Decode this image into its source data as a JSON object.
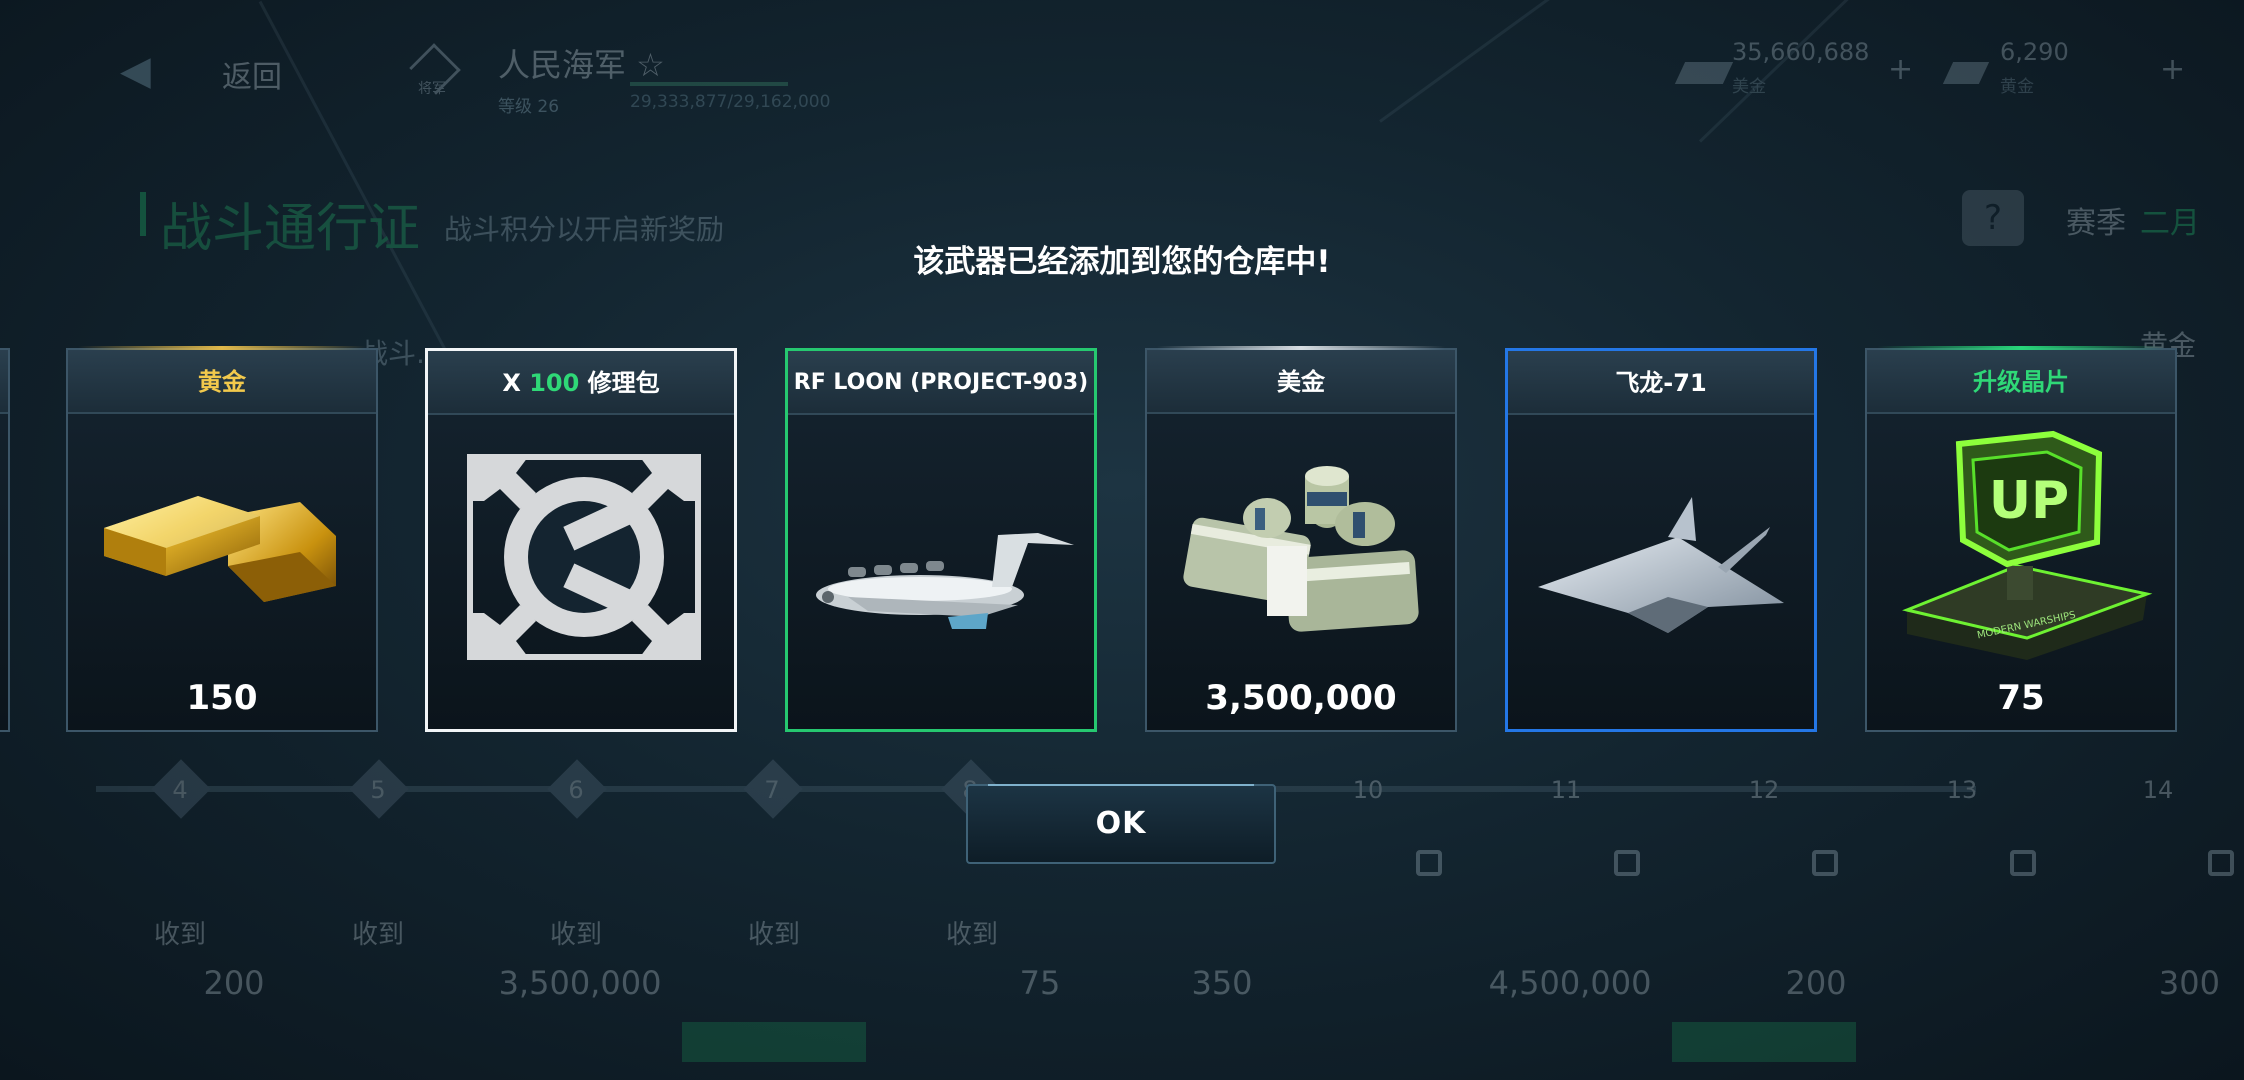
{
  "background": {
    "back_label": "返回",
    "rank_caption": "将军",
    "nation": "人民海军 ☆",
    "level": "等级 26",
    "xp": "29,333,877/29,162,000",
    "currency_usd_amount": "35,660,688",
    "currency_usd_label": "美金",
    "currency_gold_amount": "6,290",
    "currency_gold_label": "黄金",
    "plus_glyph": "+",
    "battle_pass_title": "战斗通行证",
    "battle_pass_subtitle": "战斗积分以开启新奖励",
    "help_glyph": "?",
    "season_label": "赛季",
    "season_value": "二月",
    "behind_card_title": "战斗...",
    "behind_gold": "黄金",
    "track_nodes": [
      "4",
      "5",
      "6",
      "7",
      "8",
      "10",
      "11",
      "12",
      "13",
      "14"
    ],
    "collect_label": "收到",
    "bottom_values": [
      "200",
      "3,500,000",
      "75",
      "350",
      "4,500,000",
      "200",
      "300"
    ]
  },
  "dialog": {
    "title": "该武器已经添加到您的仓库中!",
    "ok_label": "OK"
  },
  "rewards": [
    {
      "title": "黄金",
      "quantity": "150",
      "icon": "gold-bars-icon"
    },
    {
      "title_prefix": "X ",
      "title_count": "100",
      "title_suffix": " 修理包",
      "icon": "repair-kit-icon"
    },
    {
      "title": "RF LOON (PROJECT-903)",
      "icon": "ekranoplan-icon"
    },
    {
      "title": "美金",
      "quantity": "3,500,000",
      "icon": "cash-bundle-icon"
    },
    {
      "title": "飞龙-71",
      "icon": "stealth-drone-icon"
    },
    {
      "title": "升级晶片",
      "quantity": "75",
      "icon": "upgrade-chip-icon",
      "chip_text": "UP",
      "chip_caption": "MODERN WARSHIPS"
    }
  ],
  "colors": {
    "gold": "#f2c94c",
    "green": "#2fd877",
    "selected_white": "#f2f5f7",
    "selected_green": "#26c870",
    "selected_blue": "#2477e6"
  }
}
